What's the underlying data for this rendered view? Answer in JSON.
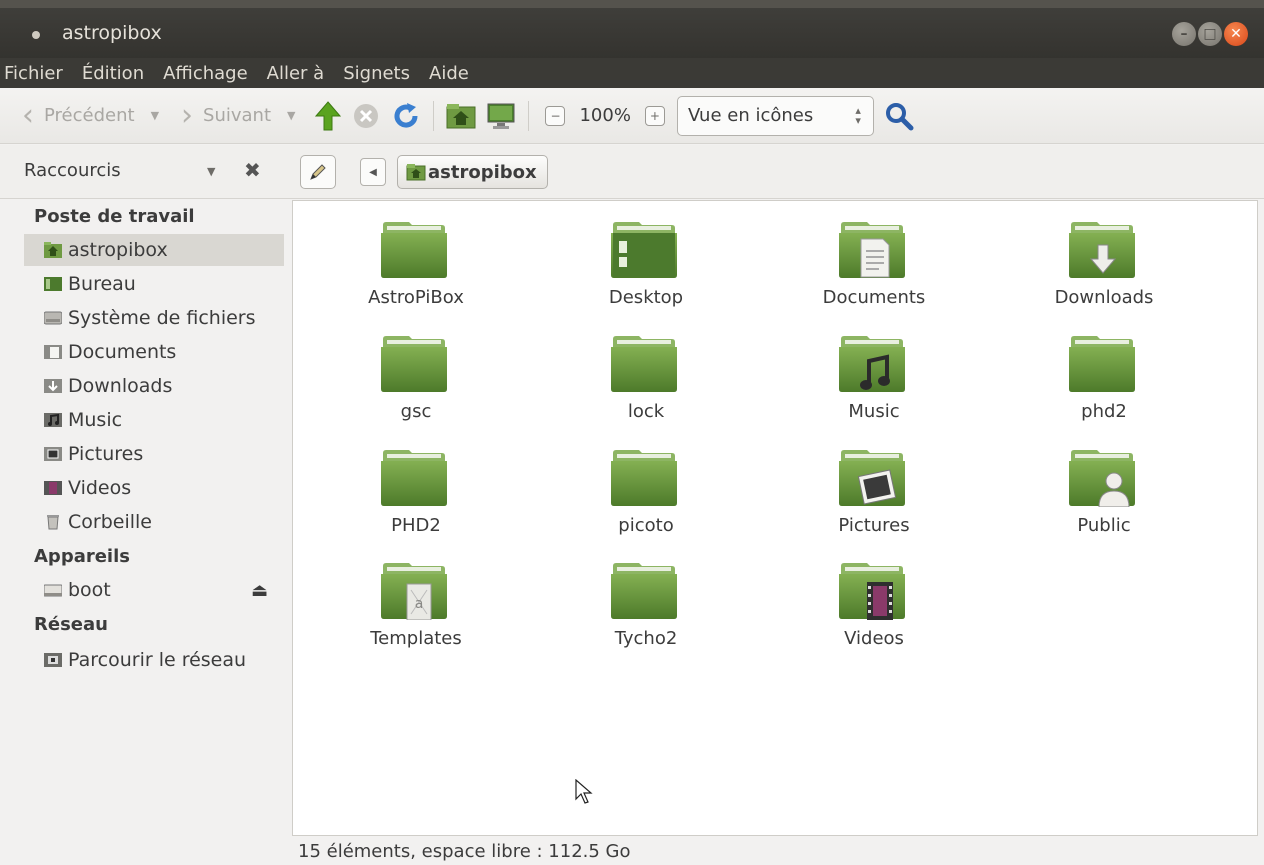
{
  "window": {
    "title": "astropibox"
  },
  "menubar": [
    "Fichier",
    "Édition",
    "Affichage",
    "Aller à",
    "Signets",
    "Aide"
  ],
  "toolbar": {
    "back_label": "Précédent",
    "forward_label": "Suivant",
    "zoom": "100%",
    "view_mode": "Vue en icônes"
  },
  "locationbar": {
    "places_label": "Raccourcis",
    "crumb": "astropibox"
  },
  "sidebar": {
    "sections": [
      {
        "heading": "Poste de travail"
      },
      {
        "heading": "Appareils"
      },
      {
        "heading": "Réseau"
      }
    ],
    "items": [
      {
        "label": "astropibox",
        "icon": "home-folder-icon"
      },
      {
        "label": "Bureau",
        "icon": "desktop-icon"
      },
      {
        "label": "Système de fichiers",
        "icon": "drive-icon"
      },
      {
        "label": "Documents",
        "icon": "documents-icon"
      },
      {
        "label": "Downloads",
        "icon": "downloads-icon"
      },
      {
        "label": "Music",
        "icon": "music-icon"
      },
      {
        "label": "Pictures",
        "icon": "pictures-icon"
      },
      {
        "label": "Videos",
        "icon": "videos-icon"
      },
      {
        "label": "Corbeille",
        "icon": "trash-icon"
      },
      {
        "label": "boot",
        "icon": "disk-icon"
      },
      {
        "label": "Parcourir le réseau",
        "icon": "network-icon"
      }
    ]
  },
  "files": [
    {
      "name": "AstroPiBox",
      "emblem": ""
    },
    {
      "name": "Desktop",
      "emblem": "desktop"
    },
    {
      "name": "Documents",
      "emblem": "document"
    },
    {
      "name": "Downloads",
      "emblem": "download"
    },
    {
      "name": "gsc",
      "emblem": ""
    },
    {
      "name": "lock",
      "emblem": ""
    },
    {
      "name": "Music",
      "emblem": "music"
    },
    {
      "name": "phd2",
      "emblem": ""
    },
    {
      "name": "PHD2",
      "emblem": ""
    },
    {
      "name": "picoto",
      "emblem": ""
    },
    {
      "name": "Pictures",
      "emblem": "picture"
    },
    {
      "name": "Public",
      "emblem": "person"
    },
    {
      "name": "Templates",
      "emblem": "template"
    },
    {
      "name": "Tycho2",
      "emblem": ""
    },
    {
      "name": "Videos",
      "emblem": "video"
    }
  ],
  "statusbar": {
    "text": "15 éléments, espace libre : 112.5 Go"
  },
  "colors": {
    "folder_green": "#6f9a42",
    "titlebar": "#3c3b37",
    "close_orange": "#e9531e"
  }
}
